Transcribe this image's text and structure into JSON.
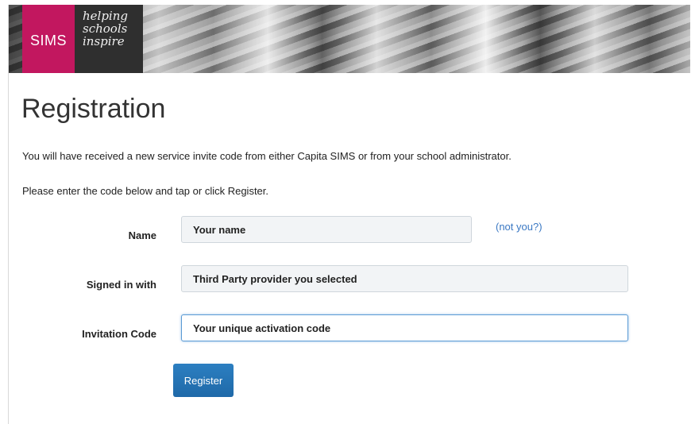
{
  "brand": {
    "logo": "SIMS",
    "tagline": [
      "helping",
      "schools",
      "inspire"
    ],
    "logo_color": "#c2175f"
  },
  "page": {
    "title": "Registration",
    "intro_line1": "You will have received a new service invite code from either Capita SIMS or from your school administrator.",
    "intro_line2": "Please enter the code below and tap or click Register."
  },
  "form": {
    "name": {
      "label": "Name",
      "value": "Your name",
      "not_you_link": "(not you?)"
    },
    "signed_in_with": {
      "label": "Signed in with",
      "value": "Third Party provider you selected"
    },
    "invitation_code": {
      "label": "Invitation Code",
      "value": "Your unique activation code"
    },
    "register_label": "Register"
  },
  "colors": {
    "accent": "#1f69a8",
    "link": "#3a78c3",
    "focus_border": "#5b9bd5"
  }
}
